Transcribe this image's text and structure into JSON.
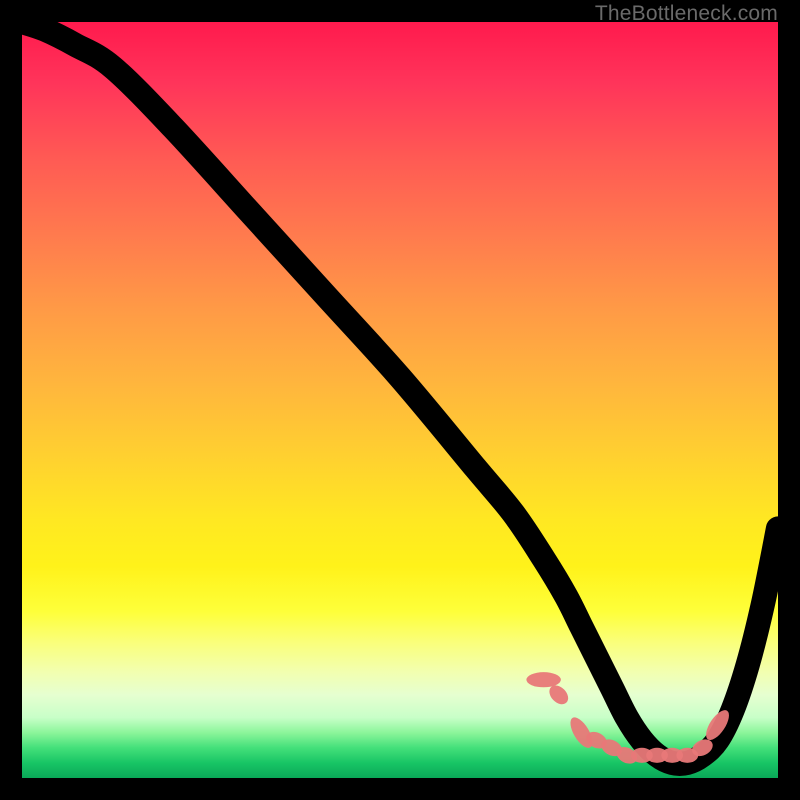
{
  "watermark": "TheBottleneck.com",
  "colors": {
    "background": "#000000",
    "curve": "#000000",
    "marker": "#e87878"
  },
  "chart_data": {
    "type": "line",
    "title": "",
    "xlabel": "",
    "ylabel": "",
    "xlim": [
      0,
      100
    ],
    "ylim": [
      0,
      100
    ],
    "series": [
      {
        "name": "bottleneck-curve",
        "x": [
          0,
          3,
          7,
          12,
          20,
          30,
          40,
          50,
          60,
          65,
          69,
          72,
          74,
          76,
          78,
          80,
          82,
          84,
          86,
          88,
          90,
          92,
          94,
          96,
          98,
          100
        ],
        "values": [
          100,
          99,
          97,
          94,
          86,
          75,
          64,
          53,
          41,
          35,
          29,
          24,
          20,
          16,
          12,
          8,
          5,
          3,
          2,
          2,
          3,
          5,
          9,
          15,
          23,
          33
        ]
      }
    ],
    "markers": {
      "name": "highlighted-points",
      "x": [
        69,
        71,
        74,
        76,
        78,
        80,
        82,
        84,
        86,
        88,
        90,
        92
      ],
      "values": [
        13,
        11,
        6,
        5,
        4,
        3,
        3,
        3,
        3,
        3,
        4,
        7
      ],
      "style": "pill"
    },
    "grid": false,
    "legend": false
  }
}
